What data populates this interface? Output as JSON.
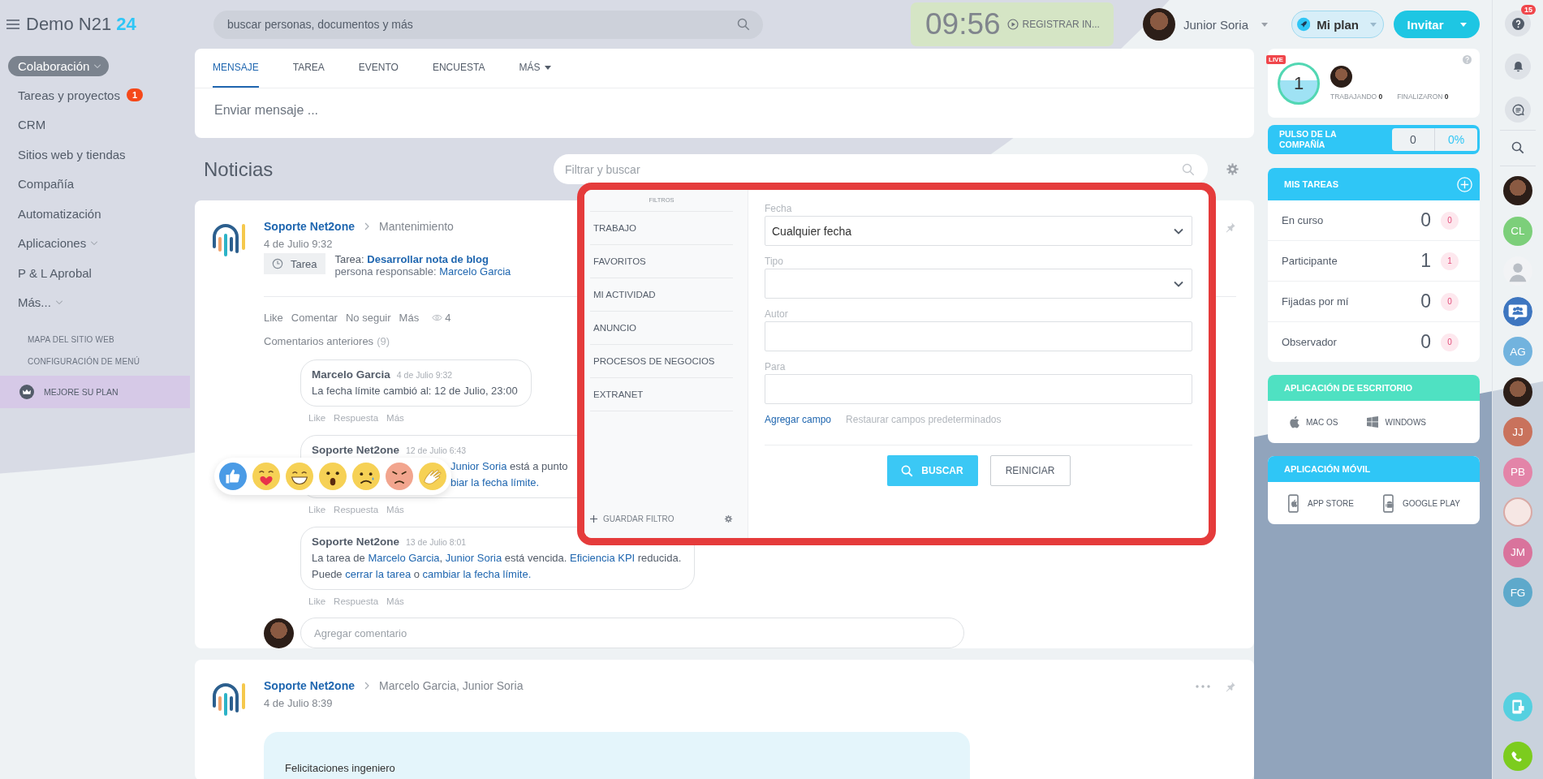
{
  "header": {
    "logo": {
      "text": "Demo N21",
      "accent": "24"
    },
    "search": {
      "placeholder": "buscar personas, documentos y más"
    },
    "clock": {
      "time": "09:56",
      "action": "REGISTRAR IN..."
    },
    "user": {
      "name": "Junior Soria"
    },
    "plan_button": "Mi plan",
    "invite_button": "Invitar"
  },
  "sidebar": {
    "items": [
      {
        "label": "Colaboración",
        "selected": true,
        "caret": true
      },
      {
        "label": "Tareas y proyectos",
        "selected": false,
        "caret": false,
        "badge": "1"
      },
      {
        "label": "CRM",
        "selected": false,
        "caret": false
      },
      {
        "label": "Sitios web y tiendas",
        "selected": false,
        "caret": false
      },
      {
        "label": "Compañía",
        "selected": false,
        "caret": false
      },
      {
        "label": "Automatización",
        "selected": false,
        "caret": false
      },
      {
        "label": "Aplicaciones",
        "selected": false,
        "caret": true
      },
      {
        "label": "P & L Aprobal",
        "selected": false,
        "caret": false
      },
      {
        "label": "Más...",
        "selected": false,
        "caret": true
      }
    ],
    "links": [
      "MAPA DEL SITIO WEB",
      "CONFIGURACIÓN DE MENÚ"
    ],
    "upgrade": "MEJORE SU PLAN"
  },
  "composer": {
    "tabs": [
      {
        "label": "MENSAJE",
        "selected": true,
        "dropdown": false
      },
      {
        "label": "TAREA",
        "selected": false,
        "dropdown": false
      },
      {
        "label": "EVENTO",
        "selected": false,
        "dropdown": false
      },
      {
        "label": "ENCUESTA",
        "selected": false,
        "dropdown": false
      },
      {
        "label": "MÁS",
        "selected": false,
        "dropdown": true
      }
    ],
    "placeholder": "Enviar mensaje ..."
  },
  "feed": {
    "title": "Noticias",
    "filter_search": {
      "placeholder": "Filtrar y buscar"
    }
  },
  "filter_popup": {
    "title": "FILTROS",
    "presets": [
      "TRABAJO",
      "FAVORITOS",
      "MI ACTIVIDAD",
      "ANUNCIO",
      "PROCESOS DE NEGOCIOS",
      "EXTRANET"
    ],
    "save": "GUARDAR FILTRO",
    "fields": [
      {
        "label": "Fecha",
        "kind": "select",
        "value": "Cualquier fecha"
      },
      {
        "label": "Tipo",
        "kind": "select"
      },
      {
        "label": "Autor",
        "kind": "input"
      },
      {
        "label": "Para",
        "kind": "input"
      }
    ],
    "add_field": "Agregar campo",
    "restore": "Restaurar campos predeterminados",
    "search_button": "BUSCAR",
    "reset_button": "REINICIAR"
  },
  "posts": [
    {
      "author": "Soporte Net2one",
      "target": "Mantenimiento",
      "date": "4 de Julio 9:32",
      "more_menu": false,
      "task": {
        "tag": "Tarea",
        "label": "Tarea:",
        "title": "Desarrollar nota de blog",
        "responsible_label": "persona responsable:",
        "responsible": "Marcelo Garcia"
      },
      "actions": [
        "Like",
        "Comentar",
        "No seguir",
        "Más"
      ],
      "views": "4",
      "previous_comments": {
        "label": "Comentarios anteriores",
        "count": "(9)"
      },
      "comments": [
        {
          "author": "Marcelo Garcia",
          "date": "4 de Julio 9:32",
          "lines": [
            [
              {
                "text": "La fecha límite cambió al: 12 de Julio, 23:00",
                "link": false
              }
            ]
          ],
          "actions": [
            "Like",
            "Respuesta",
            "Más"
          ],
          "reaction_bar": false
        },
        {
          "author": "Soporte Net2one",
          "date": "12 de Julio 6:43",
          "lines": [
            [
              {
                "text": "Junior Soria",
                "link": true
              },
              {
                "text": " está a punto",
                "link": false
              }
            ],
            [
              {
                "text": "biar la fecha límite.",
                "link": true
              }
            ]
          ],
          "actions": [
            "Like",
            "Respuesta",
            "Más"
          ],
          "reaction_bar": true
        },
        {
          "author": "Soporte Net2one",
          "date": "13 de Julio 8:01",
          "lines": [
            [
              {
                "text": "La tarea de ",
                "link": false
              },
              {
                "text": "Marcelo Garcia",
                "link": true
              },
              {
                "text": ", ",
                "link": false
              },
              {
                "text": "Junior Soria",
                "link": true
              },
              {
                "text": " está vencida. ",
                "link": false
              },
              {
                "text": "Eficiencia KPI",
                "link": true
              },
              {
                "text": " reducida.",
                "link": false
              }
            ],
            [
              {
                "text": "Puede ",
                "link": false
              },
              {
                "text": "cerrar la tarea",
                "link": true
              },
              {
                "text": " o ",
                "link": false
              },
              {
                "text": "cambiar la fecha límite.",
                "link": true
              }
            ]
          ],
          "actions": [
            "Like",
            "Respuesta",
            "Más"
          ],
          "reaction_bar": false
        }
      ],
      "add_comment": {
        "placeholder": "Agregar comentario"
      }
    },
    {
      "author": "Soporte Net2one",
      "target": "Marcelo Garcia, Junior Soria",
      "date": "4 de Julio 8:39",
      "more_menu": true,
      "message": "Felicitaciones ingeniero"
    }
  ],
  "widgets": {
    "timeman": {
      "live": "LIVE",
      "count": "1",
      "working": "TRABAJANDO **0**",
      "finished": "FINALIZARON **0**"
    },
    "pulse": {
      "title": "PULSO DE LA COMPAÑÍA",
      "value": "0",
      "percent": "0%"
    },
    "tasks": {
      "title": "MIS TAREAS",
      "rows": [
        {
          "label": "En curso",
          "count": "0",
          "badge": "0"
        },
        {
          "label": "Participante",
          "count": "1",
          "badge": "1"
        },
        {
          "label": "Fijadas por mí",
          "count": "0",
          "badge": "0"
        },
        {
          "label": "Observador",
          "count": "0",
          "badge": "0"
        }
      ]
    },
    "desktop_apps": {
      "title": "APLICACIÓN DE ESCRITORIO",
      "items": [
        {
          "label": "MAC OS",
          "kind": "apple"
        },
        {
          "label": "WINDOWS",
          "kind": "windows"
        }
      ]
    },
    "mobile_apps": {
      "title": "APLICACIÓN MÓVIL",
      "items": [
        {
          "label": "APP STORE",
          "kind": "apple"
        },
        {
          "label": "GOOGLE PLAY",
          "kind": "android"
        }
      ]
    }
  },
  "rail": {
    "help_badge": "15",
    "contacts": [
      {
        "kind": "photo"
      },
      {
        "kind": "initials",
        "initials": "CL",
        "color": "#7ccf7a"
      },
      {
        "kind": "silhouette"
      },
      {
        "kind": "group"
      },
      {
        "kind": "initials",
        "initials": "AG",
        "color": "#72b3de"
      },
      {
        "kind": "photo"
      },
      {
        "kind": "initials",
        "initials": "JJ",
        "color": "#c9725c"
      },
      {
        "kind": "initials",
        "initials": "PB",
        "color": "#e384a8"
      },
      {
        "kind": "drawing"
      },
      {
        "kind": "initials",
        "initials": "JM",
        "color": "#d9739c"
      },
      {
        "kind": "initials",
        "initials": "FG",
        "color": "#5ea9cb"
      }
    ]
  }
}
